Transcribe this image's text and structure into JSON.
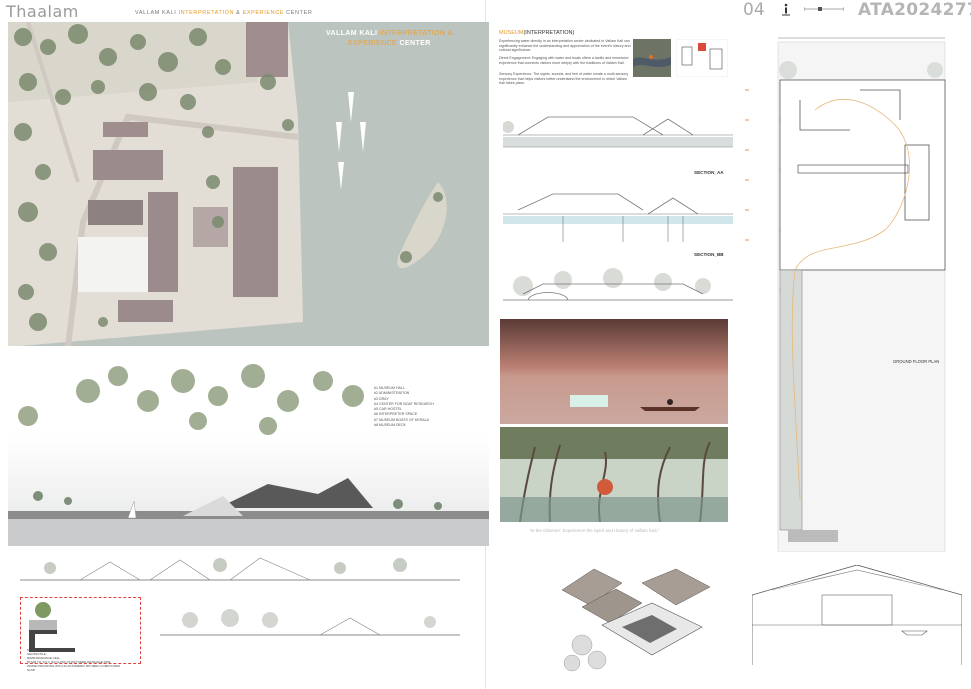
{
  "header": {
    "brand": "Thaalam",
    "title_prefix": "VALLAM KALI ",
    "title_accent1": "INTERPRETATION",
    "title_mid": " & ",
    "title_accent2": "EXPERIENCE",
    "title_suffix": " CENTER"
  },
  "site_plan": {
    "title_line1": "VALLAM KALI ",
    "title_line1_accent": "INTERPRETATION &",
    "title_line2_accent": "EXPERIENCE",
    "title_line2": " CENTER",
    "legend": [
      "#1 MUSEUM HALL",
      "#2 ADMINISTRATION",
      "#3 DRAY",
      "#4 CENTER FOR BOAT RESEARCH",
      "#5 CAR HOSTEL",
      "#6 INTERPRETER SPACE",
      "#7 MUSEUM BOATS OF KERALA",
      "#8 MUSEUM DECK"
    ]
  },
  "detail": {
    "lines": [
      "SOIL",
      "GEOTEXTILE",
      "50MM DRAINAGE CELL",
      "50 MM TH. P.V.C. B.N.S.PNG PUNCTURED DRAINAGE PIPE",
      "WATER PROOFING WITH PLASTOMERIC BITUMEN COMPOUNDS",
      "SLAB"
    ]
  },
  "right_header": {
    "page_number": "04",
    "reg_code": "ATA2024277"
  },
  "museum": {
    "heading": "MUSEUM",
    "heading_suffix": "(INTERPRETATION)",
    "para1": "Experiencing water directly in an interpretation center dedicated to Vallam Kali can significantly enhance the understanding and appreciation of the event's history and cultural significance.",
    "para2": "Direct Engagement: Engaging with water and boats offers a tactile and immersive experience that connects visitors more deeply with the traditions of Vallam Kali.",
    "para3": "Sensory Experience: The sights, sounds, and feel of water create a multi-sensory experience that helps visitors better understand the environment in which Vallam Kali takes place."
  },
  "labels": {
    "section_aa": "SECTION_AA",
    "section_bb": "SECTION_BB",
    "elevation": "ELEVATION",
    "ground_floor_plan": "GROUND FLOOR PLAN",
    "quote": "\"In the Glimmer: Experience the Spirit and History of Vallam Kali.\""
  },
  "colors": {
    "accent": "#e09a2b",
    "water": "#bcc4bf",
    "roof": "#9b8b8c"
  }
}
